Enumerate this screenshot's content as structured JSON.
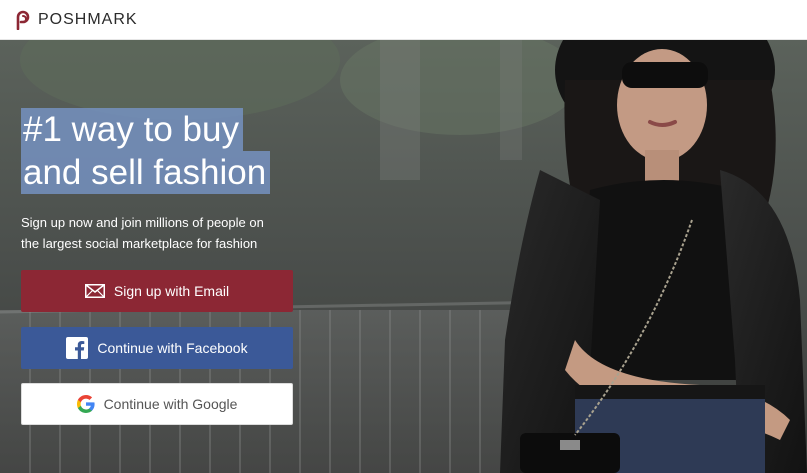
{
  "header": {
    "brand": "POSHMARK",
    "logo_icon": "poshmark-logo-icon",
    "brand_color": "#8c2734"
  },
  "hero": {
    "headline_line1": "#1 way to buy",
    "headline_line2": "and sell fashion",
    "subtext_line1": "Sign up now and join millions of people on",
    "subtext_line2": "the largest social marketplace for fashion"
  },
  "buttons": {
    "email": {
      "label": "Sign up with Email",
      "icon": "envelope-icon",
      "color": "#8c2734"
    },
    "facebook": {
      "label": "Continue with Facebook",
      "icon": "facebook-icon",
      "color": "#3b5998"
    },
    "google": {
      "label": "Continue with Google",
      "icon": "google-icon",
      "color": "#ffffff"
    }
  }
}
